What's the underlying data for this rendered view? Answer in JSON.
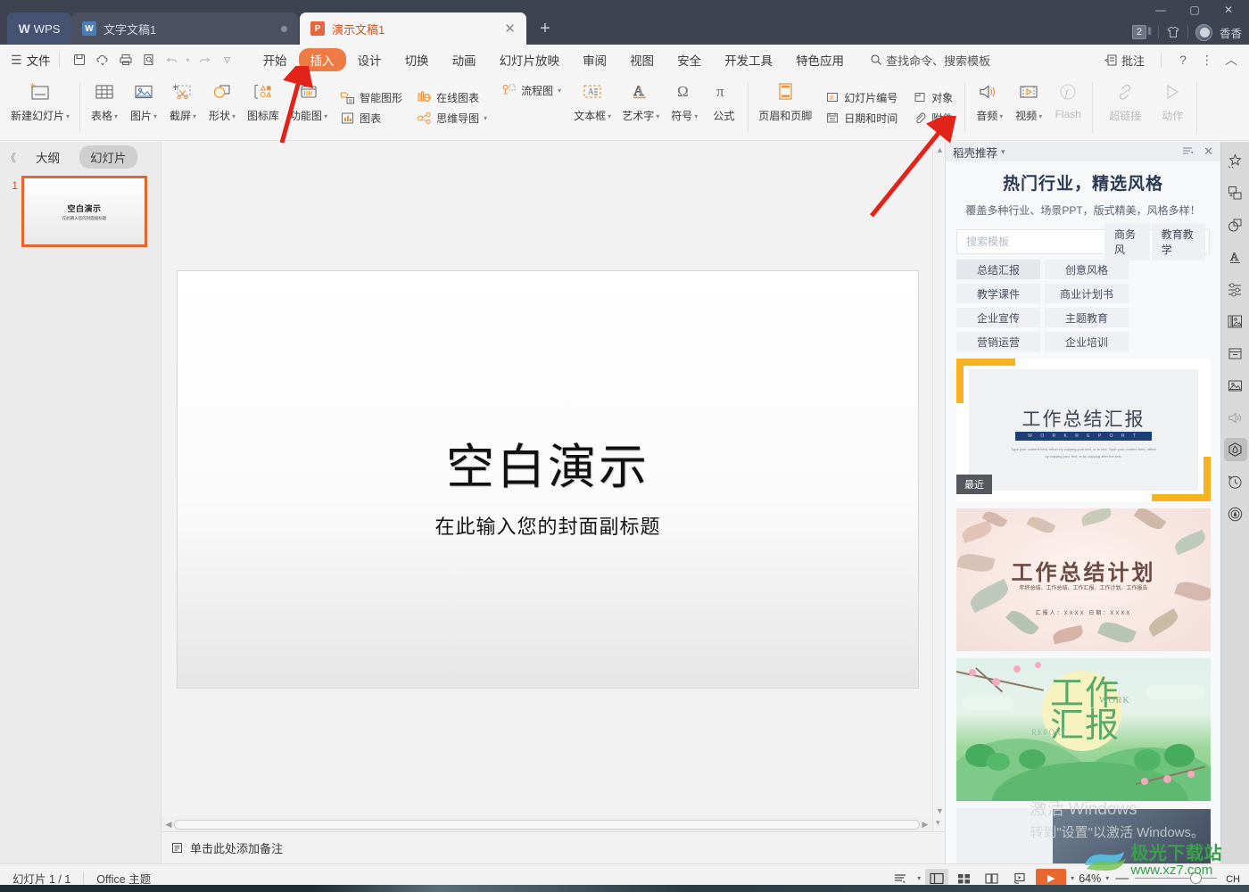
{
  "titlebar": {
    "wps_label": "WPS",
    "tabs": [
      {
        "label": "文字文稿1",
        "type": "writer",
        "active": false
      },
      {
        "label": "演示文稿1",
        "type": "presentation",
        "active": true
      }
    ],
    "new_tab_label": "+",
    "count_badge": "2",
    "user_name": "香香",
    "window_minimize": "—",
    "window_maximize": "▢",
    "window_close": "✕"
  },
  "menubar": {
    "file_label": "文件",
    "quick_access": [
      "save-icon",
      "cloud-sync-icon",
      "print-icon",
      "print-preview-icon",
      "undo-icon",
      "redo-icon",
      "customize-icon"
    ],
    "tabs": [
      {
        "label": "开始",
        "active": false
      },
      {
        "label": "插入",
        "active": true
      },
      {
        "label": "设计",
        "active": false
      },
      {
        "label": "切换",
        "active": false
      },
      {
        "label": "动画",
        "active": false
      },
      {
        "label": "幻灯片放映",
        "active": false
      },
      {
        "label": "审阅",
        "active": false
      },
      {
        "label": "视图",
        "active": false
      },
      {
        "label": "安全",
        "active": false
      },
      {
        "label": "开发工具",
        "active": false
      },
      {
        "label": "特色应用",
        "active": false
      }
    ],
    "search_placeholder": "查找命令、搜索模板",
    "annotate_label": "批注",
    "help_label": "?",
    "more_label": "⋮",
    "collapse_label": "︿",
    "accent_color": "#ee7b44"
  },
  "ribbon": {
    "groups": [
      {
        "type": "big",
        "buttons": [
          {
            "label": "新建幻灯片",
            "icon": "new-slide-icon",
            "dropdown": true,
            "disabled": false
          }
        ]
      },
      {
        "type": "big",
        "buttons": [
          {
            "label": "表格",
            "icon": "table-icon",
            "dropdown": true,
            "disabled": false
          },
          {
            "label": "图片",
            "icon": "picture-icon",
            "dropdown": true,
            "disabled": false
          },
          {
            "label": "截屏",
            "icon": "screenshot-icon",
            "dropdown": true,
            "disabled": false
          },
          {
            "label": "形状",
            "icon": "shapes-icon",
            "dropdown": true,
            "disabled": false
          },
          {
            "label": "图标库",
            "icon": "icon-library-icon",
            "dropdown": false,
            "disabled": false
          },
          {
            "label": "功能图",
            "icon": "function-chart-icon",
            "dropdown": true,
            "disabled": false
          }
        ]
      },
      {
        "type": "small",
        "columns": [
          [
            {
              "label": "智能图形",
              "icon": "smartart-icon",
              "dropdown": false
            },
            {
              "label": "图表",
              "icon": "chart-icon",
              "dropdown": false
            }
          ],
          [
            {
              "label": "在线图表",
              "icon": "online-chart-icon",
              "dropdown": false
            },
            {
              "label": "思维导图",
              "icon": "mindmap-icon",
              "dropdown": true
            }
          ],
          [
            {
              "label": "流程图",
              "icon": "flowchart-icon",
              "dropdown": true
            }
          ]
        ]
      },
      {
        "type": "big",
        "buttons": [
          {
            "label": "文本框",
            "icon": "textbox-icon",
            "dropdown": true,
            "disabled": false
          },
          {
            "label": "艺术字",
            "icon": "wordart-icon",
            "dropdown": true,
            "disabled": false
          },
          {
            "label": "符号",
            "icon": "symbol-icon",
            "dropdown": true,
            "disabled": false
          },
          {
            "label": "公式",
            "icon": "equation-icon",
            "dropdown": false,
            "disabled": false
          }
        ]
      },
      {
        "type": "big",
        "buttons": [
          {
            "label": "页眉和页脚",
            "icon": "header-footer-icon",
            "dropdown": false,
            "disabled": false
          }
        ]
      },
      {
        "type": "small",
        "columns": [
          [
            {
              "label": "幻灯片编号",
              "icon": "slide-number-icon",
              "dropdown": false
            },
            {
              "label": "日期和时间",
              "icon": "date-time-icon",
              "dropdown": false
            }
          ],
          [
            {
              "label": "对象",
              "icon": "object-icon",
              "dropdown": false
            },
            {
              "label": "附件",
              "icon": "attachment-icon",
              "dropdown": false
            }
          ]
        ]
      },
      {
        "type": "big",
        "buttons": [
          {
            "label": "音频",
            "icon": "audio-icon",
            "dropdown": true,
            "disabled": false
          },
          {
            "label": "视频",
            "icon": "video-icon",
            "dropdown": true,
            "disabled": false
          },
          {
            "label": "Flash",
            "icon": "flash-icon",
            "dropdown": false,
            "disabled": true
          }
        ]
      },
      {
        "type": "big",
        "buttons": [
          {
            "label": "超链接",
            "icon": "hyperlink-icon",
            "dropdown": false,
            "disabled": true
          },
          {
            "label": "动作",
            "icon": "action-icon",
            "dropdown": false,
            "disabled": true
          }
        ]
      }
    ]
  },
  "leftpanel": {
    "collapse_label": "《",
    "tabs": [
      {
        "label": "大纲",
        "active": false
      },
      {
        "label": "幻灯片",
        "active": true
      }
    ],
    "slides": [
      {
        "number": "1",
        "title": "空白演示",
        "subtitle": "在此输入您的封面副标题",
        "selected": true
      }
    ]
  },
  "slide": {
    "title": "空白演示",
    "subtitle": "在此输入您的封面副标题"
  },
  "notes": {
    "placeholder": "单击此处添加备注",
    "icon": "notes-icon"
  },
  "rightpanel": {
    "header_title": "稻壳推荐",
    "header_dropdown": "▾",
    "filter_icon": "filter-icon",
    "close_icon": "close-icon",
    "title": "热门行业，精选风格",
    "subtitle": "覆盖多种行业、场景PPT，版式精美，风格多样！",
    "search_placeholder": "搜索模板",
    "search_chips": [
      "商务风",
      "教育教学"
    ],
    "chips": [
      "总结汇报",
      "创意风格",
      "教学课件",
      "商业计划书",
      "企业宣传",
      "主题教育",
      "营销运营",
      "企业培训"
    ],
    "templates": [
      {
        "id": "tpl-work-summary-report",
        "title": "工作总结汇报",
        "band_text": "W O R K   R E P O R T",
        "body_text": "Type your content here, either by copying your text, or to text. Type your content here, either by copying your text, or by copying after the text.",
        "badge": "最近"
      },
      {
        "id": "tpl-work-summary-plan",
        "title": "工作总结计划",
        "sub1": "年终总结、工作总结、工作汇报、工作计划、工作报告",
        "sub2": "汇报人：XXXX            日期：XXXX"
      },
      {
        "id": "tpl-work-report-green",
        "title": "工作汇报",
        "word_work": "WORK",
        "word_report": "REPORT"
      }
    ]
  },
  "rail": {
    "icons": [
      {
        "name": "effects-star-icon",
        "glyph": "✧",
        "state": "normal"
      },
      {
        "name": "align-objects-icon",
        "glyph": "⧉",
        "state": "normal"
      },
      {
        "name": "shape-fill-icon",
        "glyph": "◯",
        "state": "normal"
      },
      {
        "name": "text-style-icon",
        "glyph": "A",
        "state": "normal"
      },
      {
        "name": "properties-sliders-icon",
        "glyph": "≡",
        "state": "normal"
      },
      {
        "name": "picture-layout-icon",
        "glyph": "▤",
        "state": "normal"
      },
      {
        "name": "box-archive-icon",
        "glyph": "▭",
        "state": "normal"
      },
      {
        "name": "image-icon",
        "glyph": "▣",
        "state": "normal"
      },
      {
        "name": "audio-volume-icon",
        "glyph": "◁",
        "state": "dim"
      },
      {
        "name": "hexagon-badge-icon",
        "glyph": "⬡",
        "state": "active"
      },
      {
        "name": "history-clock-icon",
        "glyph": "◴",
        "state": "normal"
      },
      {
        "name": "account-circle-icon",
        "glyph": "◉",
        "state": "normal"
      }
    ]
  },
  "statusbar": {
    "slide_counter": "幻灯片 1 / 1",
    "theme_name": "Office 主题",
    "view_icons": [
      {
        "name": "notes-view-icon",
        "active": false
      },
      {
        "name": "normal-view-icon",
        "active": true
      },
      {
        "name": "slide-sorter-icon",
        "active": false
      },
      {
        "name": "reading-view-icon",
        "active": false
      },
      {
        "name": "presenter-view-icon",
        "active": false
      }
    ],
    "play_label": "▶",
    "play_dropdown": "▾",
    "zoom_level": "64%",
    "zoom_dropdown": "▾",
    "zoom_out": "—",
    "zoom_in": "+",
    "ime_indicator": "CH"
  },
  "annotations": {
    "arrows": [
      {
        "name": "arrow-to-insert-tab",
        "color": "#e2231a"
      },
      {
        "name": "arrow-to-audio-button",
        "color": "#e2231a"
      }
    ]
  },
  "watermarks": {
    "windows_line1": "激活 Windows",
    "windows_line2": "转到\"设置\"以激活 Windows。",
    "site_name": "极光下载站",
    "site_url": "www.xz7.com"
  }
}
